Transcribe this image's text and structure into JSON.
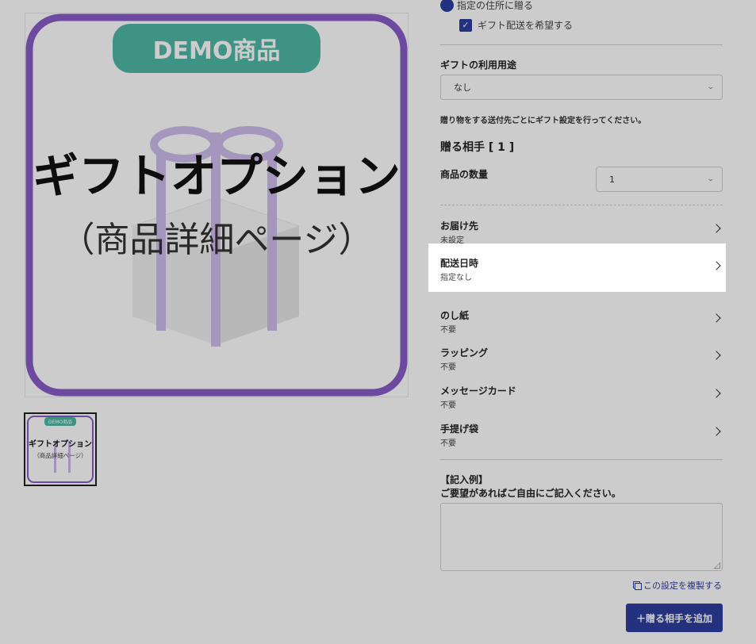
{
  "product": {
    "image_badge": "DEMO商品",
    "image_title": "ギフトオプション",
    "image_subtitle": "（商品詳細ページ）"
  },
  "gift_form": {
    "address_option": "指定の住所に贈る",
    "gift_delivery_checkbox": "ギフト配送を希望する",
    "usage_label": "ギフトの利用用途",
    "usage_value": "なし",
    "instruction_note": "贈り物をする送付先ごとにギフト設定を行ってください。",
    "recipient_title": "贈る相手 [ 1 ]",
    "quantity_label": "商品の数量",
    "quantity_value": "1",
    "settings": [
      {
        "title": "お届け先",
        "value": "未設定"
      },
      {
        "title": "配送日時",
        "value": "指定なし"
      },
      {
        "title": "のし紙",
        "value": "不要"
      },
      {
        "title": "ラッピング",
        "value": "不要"
      },
      {
        "title": "メッセージカード",
        "value": "不要"
      },
      {
        "title": "手提げ袋",
        "value": "不要"
      }
    ],
    "remarks_example": "【記入例】",
    "remarks_prompt": "ご要望があればご自由にご記入ください。",
    "copy_link": "この設定を複製する",
    "add_recipient_button": "＋贈る相手を追加"
  },
  "colors": {
    "accent": "#2c3e9e",
    "badge_green": "#4fb8a5",
    "frame_purple": "#8a5cc9"
  }
}
